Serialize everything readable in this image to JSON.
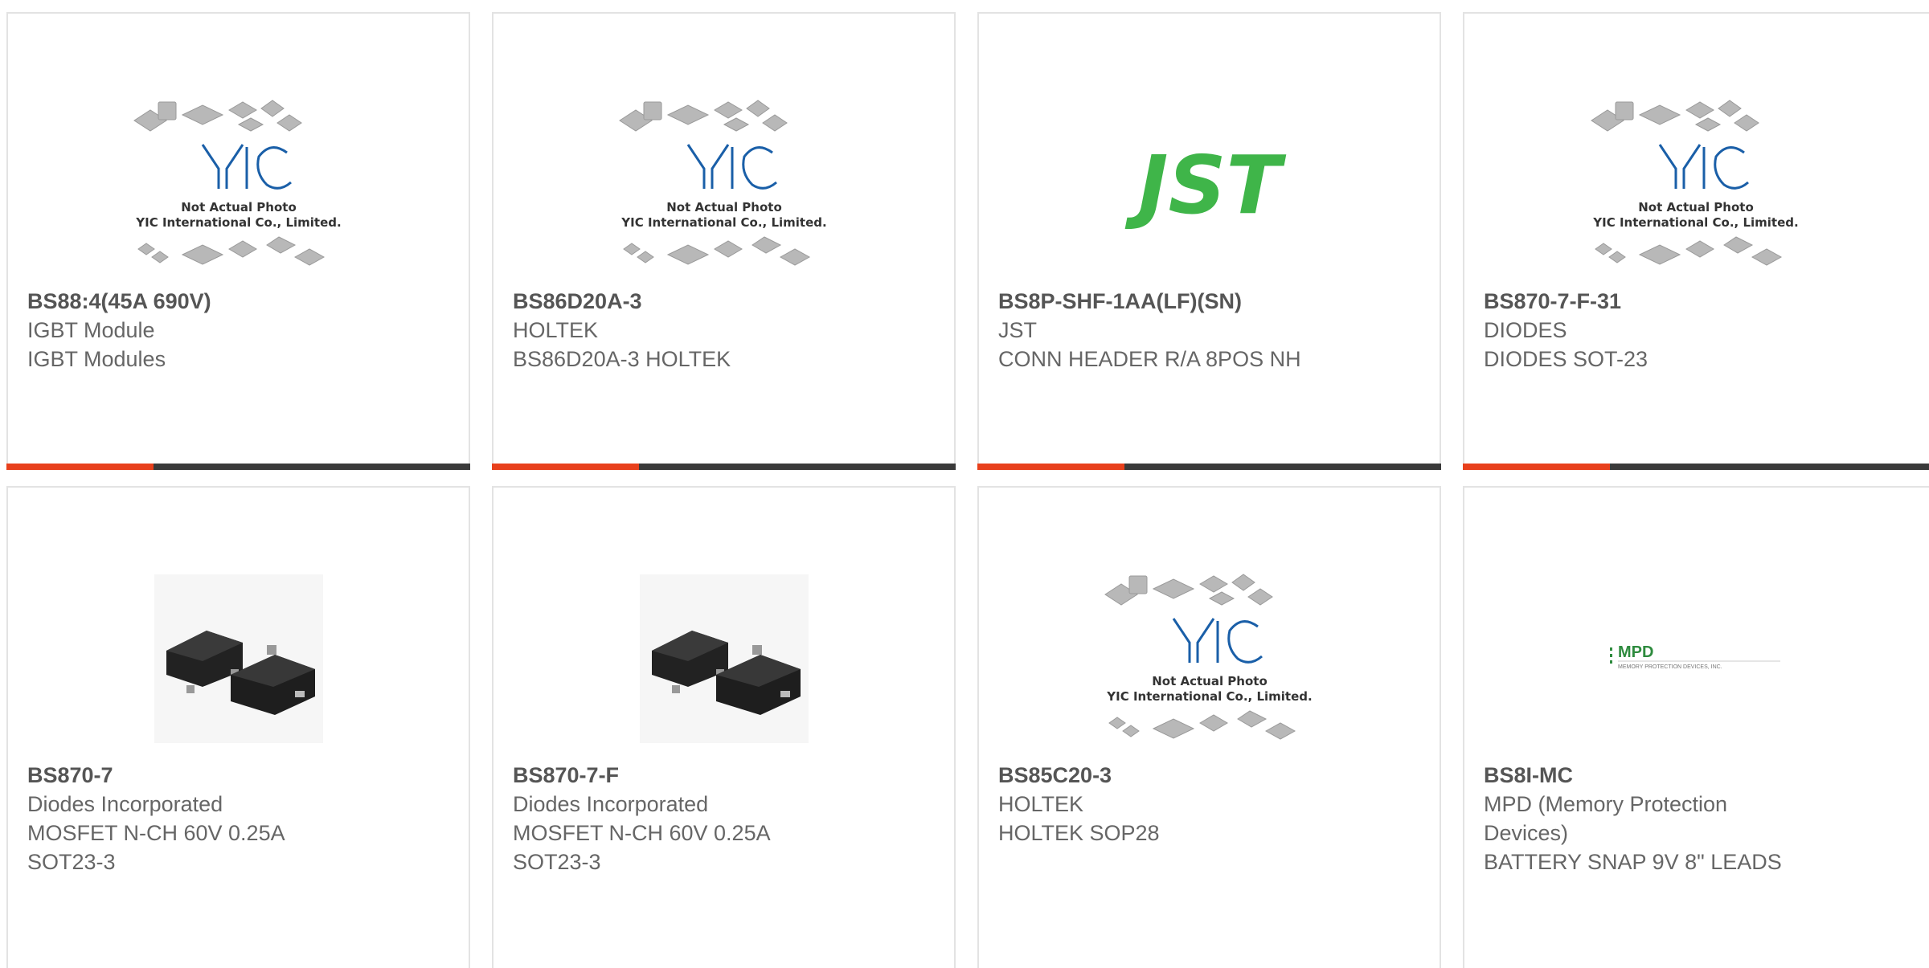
{
  "accent_color": "#e8401c",
  "bar_color": "#3a3a3a",
  "cards": [
    {
      "part": "BS88:4(45A 690V)",
      "lines": [
        "IGBT Module",
        "IGBT Modules"
      ],
      "image": "yic-placeholder",
      "image_text": [
        "Not Actual Photo",
        "YIC International Co., Limited."
      ]
    },
    {
      "part": "BS86D20A-3",
      "lines": [
        "HOLTEK",
        "BS86D20A-3 HOLTEK"
      ],
      "image": "yic-placeholder",
      "image_text": [
        "Not Actual Photo",
        "YIC International Co., Limited."
      ]
    },
    {
      "part": "BS8P-SHF-1AA(LF)(SN)",
      "lines": [
        "JST",
        "CONN HEADER R/A 8POS NH"
      ],
      "image": "jst-logo",
      "image_text": [
        "JST"
      ]
    },
    {
      "part": "BS870-7-F-31",
      "lines": [
        "DIODES",
        "DIODES SOT-23"
      ],
      "image": "yic-placeholder",
      "image_text": [
        "Not Actual Photo",
        "YIC International Co., Limited."
      ]
    },
    {
      "part": "BS870-7",
      "lines": [
        "Diodes Incorporated",
        "MOSFET N-CH 60V 0.25A",
        "SOT23-3"
      ],
      "image": "sot23-photo"
    },
    {
      "part": "BS870-7-F",
      "lines": [
        "Diodes Incorporated",
        "MOSFET N-CH 60V 0.25A",
        "SOT23-3"
      ],
      "image": "sot23-photo"
    },
    {
      "part": "BS85C20-3",
      "lines": [
        "HOLTEK",
        "HOLTEK SOP28"
      ],
      "image": "yic-placeholder",
      "image_text": [
        "Not Actual Photo",
        "YIC International Co., Limited."
      ]
    },
    {
      "part": "BS8I-MC",
      "lines": [
        "MPD (Memory Protection",
        "Devices)",
        "BATTERY SNAP 9V 8\" LEADS"
      ],
      "image": "mpd-logo",
      "image_text": [
        "MPD",
        "MEMORY PROTECTION DEVICES, INC."
      ]
    }
  ]
}
